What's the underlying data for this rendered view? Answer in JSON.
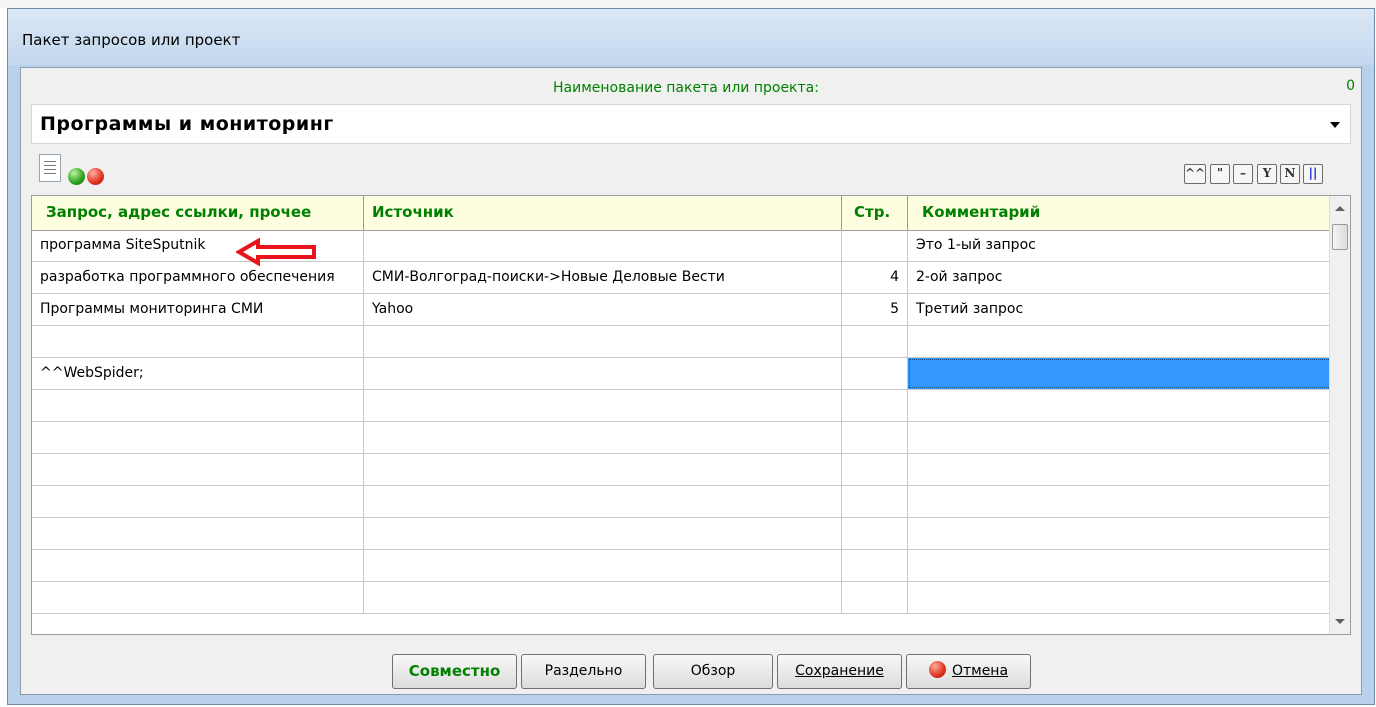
{
  "window": {
    "title": "Пакет запросов или проект"
  },
  "project": {
    "name_label": "Наименование пакета или проекта:",
    "counter": "0",
    "name_value": "Программы и мониторинг"
  },
  "icons": {
    "document": "document-icon",
    "green_ball": "green-circle-icon",
    "red_ball": "red-circle-icon",
    "arrow": "left-arrow-annotation-icon"
  },
  "toolbar_buttons": [
    {
      "label": "^^",
      "icon": "caret-quote-icon"
    },
    {
      "label": "\"",
      "icon": "quote-icon"
    },
    {
      "label": "–",
      "icon": "dash-icon"
    },
    {
      "label": "Y",
      "icon": "letter-y-icon"
    },
    {
      "label": "N",
      "icon": "letter-n-icon"
    },
    {
      "label": "||",
      "icon": "blue-bars-icon"
    }
  ],
  "grid": {
    "columns": [
      "Запрос, адрес ссылки, прочее",
      "Источник",
      "Стр.",
      "Комментарий"
    ],
    "rows": [
      [
        "программа SiteSputnik",
        "",
        "",
        "Это 1-ый запрос"
      ],
      [
        "разработка программного обеспечения",
        "СМИ-Волгоград-поиски->Новые Деловые Вести",
        "4",
        "2-ой запрос"
      ],
      [
        "Программы мониторинга СМИ",
        "Yahoo",
        "5",
        "Третий запрос"
      ],
      [
        "",
        "",
        "",
        ""
      ],
      [
        "^^WebSpider;",
        "",
        "",
        ""
      ],
      [
        "",
        "",
        "",
        ""
      ],
      [
        "",
        "",
        "",
        ""
      ],
      [
        "",
        "",
        "",
        ""
      ],
      [
        "",
        "",
        "",
        ""
      ],
      [
        "",
        "",
        "",
        ""
      ],
      [
        "",
        "",
        "",
        ""
      ],
      [
        "",
        "",
        "",
        ""
      ]
    ]
  },
  "buttons": {
    "together": "Совместно",
    "separate": "Раздельно",
    "browse": "Обзор",
    "save": "Сохранение",
    "cancel": "Отмена"
  },
  "colors": {
    "accent_green": "#008000",
    "selection_blue": "#3399ff",
    "annotation_red": "#e8141b",
    "header_bg": "#fdfde0"
  }
}
